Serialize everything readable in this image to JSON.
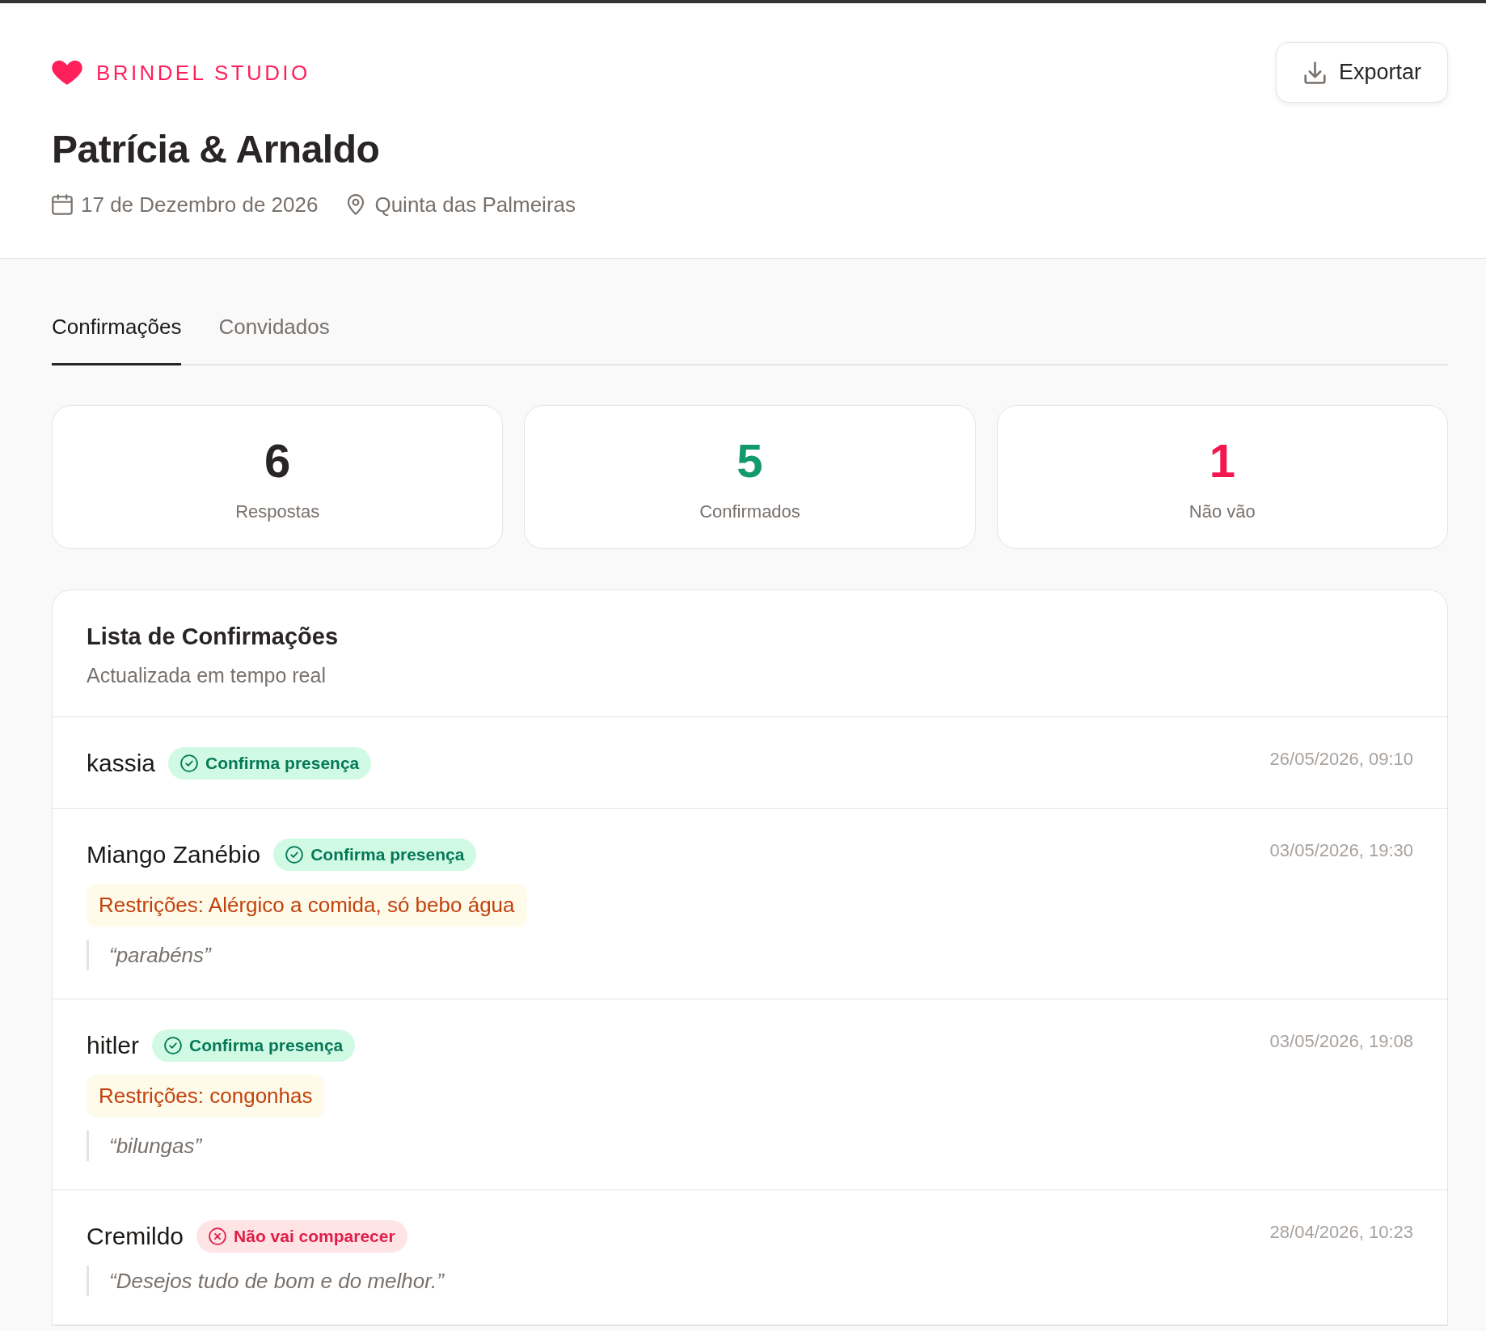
{
  "brand": {
    "name": "BRINDEL STUDIO"
  },
  "export_button": {
    "label": "Exportar"
  },
  "event": {
    "title": "Patrícia & Arnaldo",
    "date": "17 de Dezembro de 2026",
    "venue": "Quinta das Palmeiras"
  },
  "tabs": [
    {
      "label": "Confirmações",
      "selected": true
    },
    {
      "label": "Convidados",
      "selected": false
    }
  ],
  "stats": [
    {
      "value": "6",
      "label": "Respostas",
      "color": "#292524"
    },
    {
      "value": "5",
      "label": "Confirmados",
      "color": "#129a6b"
    },
    {
      "value": "1",
      "label": "Não vão",
      "color": "#f2184f"
    }
  ],
  "list": {
    "title": "Lista de Confirmações",
    "subtitle": "Actualizada em tempo real",
    "rows": [
      {
        "name": "kassia",
        "status": {
          "kind": "confirmed",
          "label": "Confirma presença"
        },
        "timestamp": "26/05/2026, 09:10"
      },
      {
        "name": "Miango Zanébio",
        "status": {
          "kind": "confirmed",
          "label": "Confirma presença"
        },
        "restrictions": "Restrições: Alérgico a comida, só bebo água",
        "message": "“parabéns”",
        "timestamp": "03/05/2026, 19:30"
      },
      {
        "name": "hitler",
        "status": {
          "kind": "confirmed",
          "label": "Confirma presença"
        },
        "restrictions": "Restrições: congonhas",
        "message": "“bilungas”",
        "timestamp": "03/05/2026, 19:08"
      },
      {
        "name": "Cremildo",
        "status": {
          "kind": "declined",
          "label": "Não vai comparecer"
        },
        "message": "“Desejos tudo de bom e do melhor.”",
        "timestamp": "28/04/2026, 10:23"
      }
    ]
  }
}
